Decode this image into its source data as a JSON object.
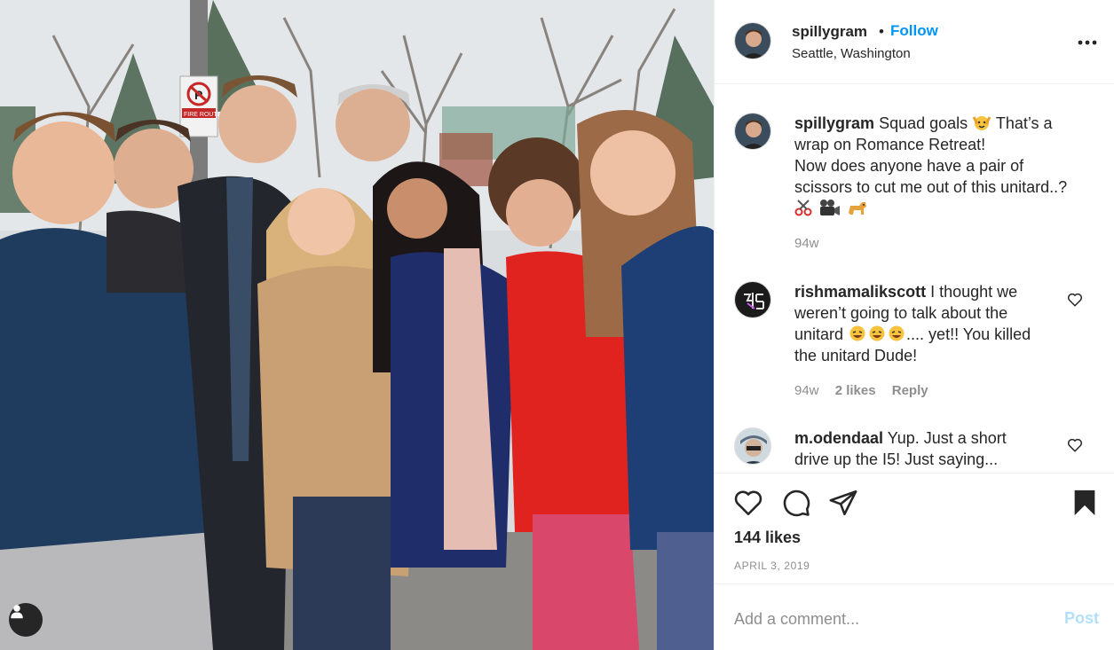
{
  "post": {
    "username": "spillygram",
    "separator": "•",
    "follow_label": "Follow",
    "location": "Seattle, Washington",
    "more_icon": "more-horizontal-icon"
  },
  "caption": {
    "username": "spillygram",
    "line1": "Squad goals ",
    "line1b": " That’s a",
    "line2": "wrap on Romance Retreat!",
    "line3": "Now does anyone have a pair of",
    "line4": "scissors to cut me out of this unitard..?",
    "emojis": [
      "scissors-emoji",
      "film-camera-emoji",
      "dog-emoji"
    ],
    "age": "94w"
  },
  "comments": [
    {
      "username": "rishmamalikscott",
      "text_a": " I thought we",
      "text_b": "weren’t going to talk about the",
      "text_c": "unitard ",
      "text_d": ".... yet!! You killed",
      "text_e": "the unitard Dude!",
      "age": "94w",
      "likes": "2 likes",
      "reply_label": "Reply"
    },
    {
      "username": "m.odendaal",
      "text_a": " Yup. Just a short",
      "text_b": "drive up the I5! Just saying..."
    }
  ],
  "actions": {
    "like_icon": "heart-icon",
    "comment_icon": "comment-icon",
    "share_icon": "paper-plane-icon",
    "save_icon": "bookmark-icon",
    "likes_count": "144 likes",
    "date": "APRIL 3, 2019"
  },
  "add_comment": {
    "placeholder": "Add a comment...",
    "post_label": "Post"
  },
  "photo": {
    "tag_icon": "user-tag-icon",
    "sign_text": "FIRE ROUTE"
  },
  "colors": {
    "link_blue": "#0095f6",
    "post_disabled": "#b2dffc",
    "muted": "#8e8e8e",
    "text": "#262626"
  }
}
